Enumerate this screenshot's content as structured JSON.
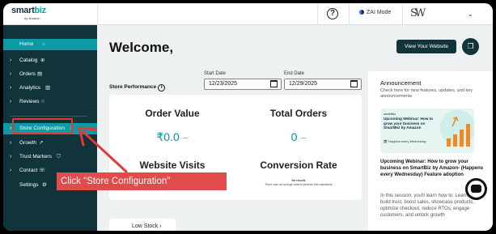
{
  "brand": {
    "name": "smartbiz",
    "sub": "by amazon"
  },
  "topbar": {
    "help_icon": "question-circle-icon",
    "zai_mode": "ZAI Mode",
    "account_monogram": "SW",
    "account_chevron": "⌄"
  },
  "sidebar": {
    "items": [
      {
        "label": "Home",
        "icon": "⌂",
        "chev": ""
      },
      {
        "label": "Catalog",
        "icon": "⊕",
        "chev": "›"
      },
      {
        "label": "Orders",
        "icon": "▤",
        "chev": "›"
      },
      {
        "label": "Analytics",
        "icon": "▥",
        "chev": "›"
      },
      {
        "label": "Reviews",
        "icon": "☆",
        "chev": "›"
      },
      {
        "label": "Store Configuration",
        "icon": "⁝",
        "chev": "›"
      },
      {
        "label": "Growth",
        "icon": "↗",
        "chev": "›"
      },
      {
        "label": "Trust Markers",
        "icon": "⛉",
        "chev": "›"
      },
      {
        "label": "Contact",
        "icon": "☏",
        "chev": "›"
      },
      {
        "label": "Settings",
        "icon": "⚙",
        "chev": ""
      }
    ]
  },
  "main": {
    "welcome": "Welcome,",
    "view_website": "View Your Website",
    "store_performance": "Store Performance",
    "start_label": "Start Date",
    "start_value": "12/23/2025",
    "end_label": "End Date",
    "end_value": "12/29/2025",
    "metrics": {
      "order_value_title": "Order Value",
      "order_value": "₹0.0",
      "total_orders_title": "Total Orders",
      "total_orders": "0",
      "website_visits_title": "Website Visits",
      "conversion_rate_title": "Conversion Rate",
      "no_results": "No results",
      "no_results_sub": "There was not enough data to perform this calculation"
    },
    "low_stock": "Low Stock"
  },
  "announcement": {
    "title": "Announcement",
    "desc": "Check here for new features, updates, and key announcements",
    "card_logo": "smartbiz",
    "card_title": "Upcoming Webinar: How to grow your business on SmartBiz by Amazon",
    "card_meta": "Happens every Wednesday",
    "headline": "Upcoming Webinar: How to grow your business on SmartBiz by Amazon- (Happens every Wednesday) Feature adoption",
    "body": "In this session, you'll learn how to: Learn how to build trust, boost sales, showcase products, optimize checkout, reduce RTOs, engage customers, and unlock growth"
  },
  "annotation": {
    "callout": "Click \"Store Configuration\"",
    "color": "#e53935"
  }
}
